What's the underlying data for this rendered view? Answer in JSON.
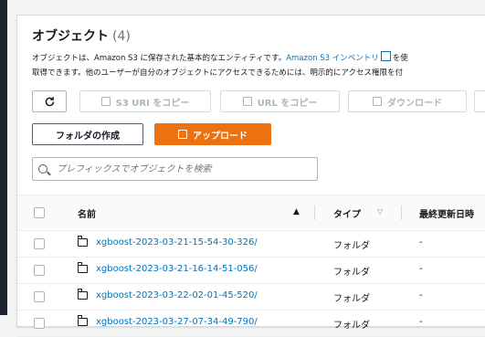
{
  "header": {
    "title": "オブジェクト",
    "count": "(4)"
  },
  "description": {
    "line1_text": "オブジェクトは、Amazon S3 に保存された基本的なエンティティです。",
    "line1_link": "Amazon S3 インベントリ",
    "line1_tail": "を使",
    "line2_text": "取得できます。他のユーザーが自分のオブジェクトにアクセスできるためには、明示的にアクセス権限を付"
  },
  "toolbar": {
    "copy_s3_uri": "S3 URI をコピー",
    "copy_url": "URL をコピー",
    "download": "ダウンロード"
  },
  "actions": {
    "create_folder": "フォルダの作成",
    "upload": "アップロード"
  },
  "search": {
    "placeholder": "プレフィックスでオブジェクトを検索"
  },
  "table": {
    "headers": {
      "name": "名前",
      "type": "タイプ",
      "modified": "最終更新日時"
    },
    "rows": [
      {
        "name": "xgboost-2023-03-21-15-54-30-326/",
        "type": "フォルダ",
        "modified": "-"
      },
      {
        "name": "xgboost-2023-03-21-16-14-51-056/",
        "type": "フォルダ",
        "modified": "-"
      },
      {
        "name": "xgboost-2023-03-22-02-01-45-520/",
        "type": "フォルダ",
        "modified": "-"
      },
      {
        "name": "xgboost-2023-03-27-07-34-49-790/",
        "type": "フォルダ",
        "modified": "-"
      }
    ]
  },
  "colors": {
    "accent": "#ec7211",
    "link": "#0073bb",
    "border": "#aab7b8"
  }
}
